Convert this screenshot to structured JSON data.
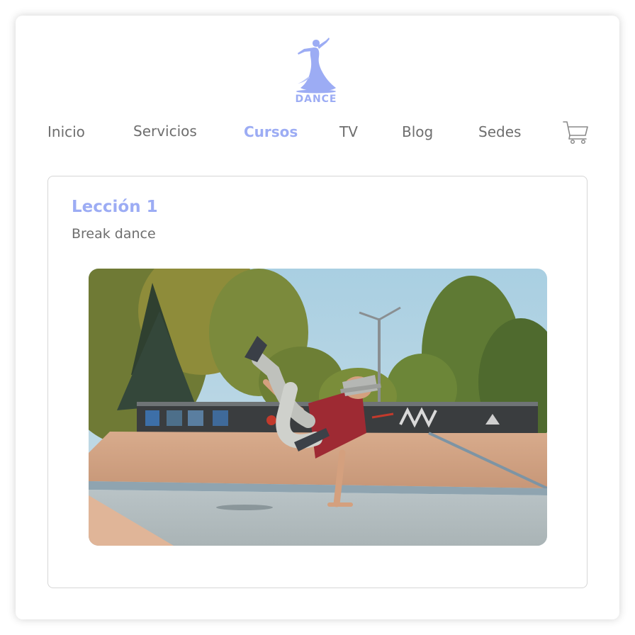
{
  "logo": {
    "text": "DANCE",
    "icon": "dancer-silhouette-icon",
    "color": "#9cacf4"
  },
  "nav": {
    "items": [
      {
        "label": "Inicio",
        "active": false
      },
      {
        "label": "Servicios",
        "active": false
      },
      {
        "label": "Cursos",
        "active": true
      },
      {
        "label": "TV",
        "active": false
      },
      {
        "label": "Blog",
        "active": false
      },
      {
        "label": "Sedes",
        "active": false
      }
    ],
    "cart_icon": "shopping-cart-icon"
  },
  "lesson": {
    "title": "Lección 1",
    "subtitle": "Break dance",
    "image": "break-dancer-skatepark-photo"
  },
  "colors": {
    "accent": "#9cacf4",
    "text": "#6e6e6e",
    "border": "#d6d6d6"
  }
}
